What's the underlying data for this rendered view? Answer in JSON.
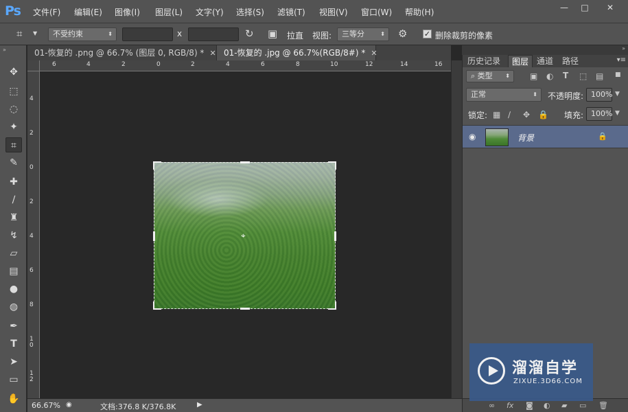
{
  "app": {
    "logo": "Ps"
  },
  "menu": [
    "文件(F)",
    "编辑(E)",
    "图像(I)",
    "图层(L)",
    "文字(Y)",
    "选择(S)",
    "滤镜(T)",
    "视图(V)",
    "窗口(W)",
    "帮助(H)"
  ],
  "window_controls": {
    "minimize": "—",
    "maximize": "□",
    "close": "✕"
  },
  "options": {
    "ratio_select": "不受约束",
    "width_value": "",
    "height_value": "",
    "x_label": "x",
    "straighten_label": "拉直",
    "view_label": "视图:",
    "view_select": "三等分",
    "delete_cropped_label": "删除裁剪的像素",
    "delete_cropped_checked": true
  },
  "tabs": [
    {
      "title": "01-恢复的 .png @ 66.7% (图层 0, RGB/8) *",
      "active": false
    },
    {
      "title": "01-恢复的 .jpg @ 66.7%(RGB/8#) *",
      "active": true
    }
  ],
  "ruler": {
    "h_labels": [
      "6",
      "4",
      "2",
      "0",
      "2",
      "4",
      "6",
      "8",
      "10",
      "12",
      "14",
      "16"
    ],
    "v_labels": [
      "4",
      "2",
      "0",
      "2",
      "4",
      "6",
      "8",
      "10",
      "12"
    ]
  },
  "status": {
    "zoom": "66.67%",
    "doc_info": "文档:376.8 K/376.8K"
  },
  "panel": {
    "tabs": [
      "历史记录",
      "图层",
      "通道",
      "路径"
    ],
    "active_tab": "图层",
    "filter_label": "类型",
    "blend_mode": "正常",
    "opacity_label": "不透明度:",
    "opacity_value": "100%",
    "lock_label": "锁定:",
    "fill_label": "填充:",
    "fill_value": "100%",
    "layers": [
      {
        "name": "背景",
        "visible": true,
        "locked": true
      }
    ]
  },
  "watermark": {
    "title": "溜溜自学",
    "subtitle": "ZIXUE.3D66.COM"
  },
  "colors": {
    "ui_bg": "#535353",
    "canvas_bg": "#282828",
    "selected_layer": "#5a6a8c",
    "watermark_bg": "#3a5a8a"
  }
}
